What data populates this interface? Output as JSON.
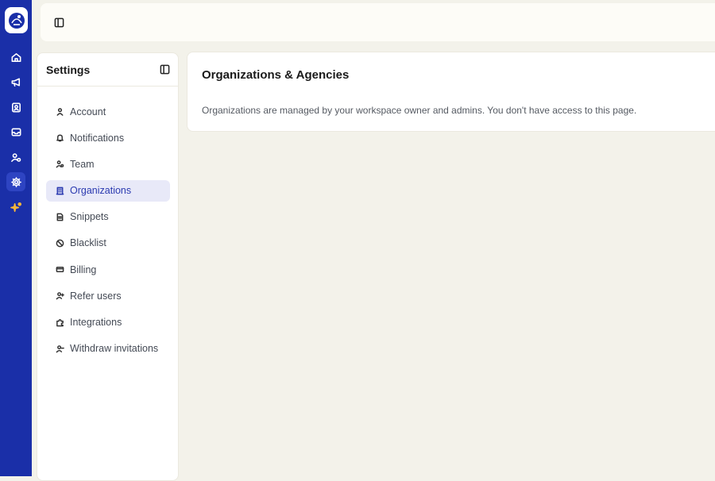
{
  "settings": {
    "title": "Settings",
    "items": [
      {
        "label": "Account",
        "icon": "user-icon"
      },
      {
        "label": "Notifications",
        "icon": "bell-icon"
      },
      {
        "label": "Team",
        "icon": "team-icon"
      },
      {
        "label": "Organizations",
        "icon": "building-icon",
        "active": true
      },
      {
        "label": "Snippets",
        "icon": "document-icon"
      },
      {
        "label": "Blacklist",
        "icon": "ban-icon"
      },
      {
        "label": "Billing",
        "icon": "credit-card-icon"
      },
      {
        "label": "Refer users",
        "icon": "user-plus-icon"
      },
      {
        "label": "Integrations",
        "icon": "puzzle-icon"
      },
      {
        "label": "Withdraw invitations",
        "icon": "user-minus-icon"
      }
    ]
  },
  "main": {
    "title": "Organizations & Agencies",
    "message": "Organizations are managed by your workspace owner and admins. You don't have access to this page."
  },
  "rail": {
    "icons": [
      "home-icon",
      "megaphone-icon",
      "contact-card-icon",
      "inbox-icon",
      "users-settings-icon",
      "settings-gear-icon",
      "sparkle-icon"
    ],
    "active": "settings-gear-icon"
  },
  "colors": {
    "rail": "#1a2fa8",
    "accent": "#2b3ab0",
    "active_bg": "#e8e9f8",
    "page_bg": "#f3f2ea"
  }
}
